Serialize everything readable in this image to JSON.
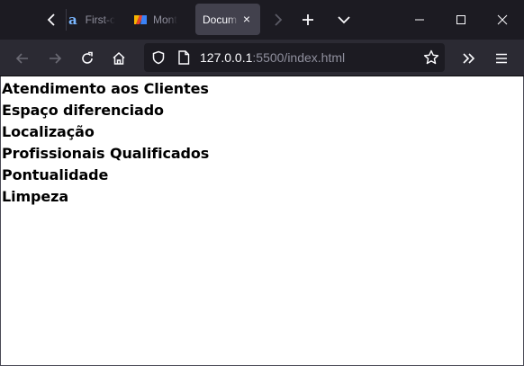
{
  "browser": {
    "tabs": [
      {
        "label": "First-c",
        "favicon": "a",
        "active": false
      },
      {
        "label": "Mont",
        "favicon": "colorful-logo-icon",
        "active": false
      },
      {
        "label": "Docum",
        "favicon": null,
        "active": true
      }
    ],
    "close_tab_glyph": "×",
    "new_tab_glyph": "+",
    "url": {
      "host": "127.0.0.1",
      "rest": ":5500/index.html"
    }
  },
  "page": {
    "items": [
      "Atendimento aos Clientes",
      "Espaço diferenciado",
      "Localização",
      "Profissionais Qualificados",
      "Pontualidade",
      "Limpeza"
    ]
  },
  "colors": {
    "tabstrip_bg": "#1c1b22",
    "navbar_bg": "#2b2a33",
    "active_tab_bg": "#42414d",
    "content_bg": "#ffffff",
    "text": "#000000"
  }
}
